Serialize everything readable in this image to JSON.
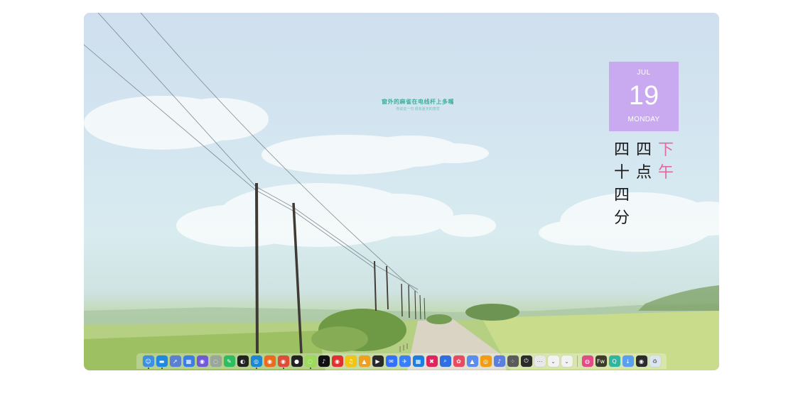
{
  "desktop": {
    "caption_main": "窗外的麻雀在电线杆上多嘴",
    "caption_sub": "你说这一句 很有夏天的感觉"
  },
  "calendar_widget": {
    "month": "JUL",
    "day": "19",
    "weekday": "MONDAY",
    "accent": "#c9a9ef"
  },
  "clock_widget": {
    "columns": [
      [
        "四",
        "十",
        "四",
        "分"
      ],
      [
        "四",
        "点"
      ],
      [
        "下",
        "午"
      ]
    ],
    "accent": "#e06b9f"
  },
  "dock": {
    "apps": [
      {
        "name": "finder",
        "glyph": "☺",
        "color": "#3d8fe0",
        "running": true
      },
      {
        "name": "photo-browser",
        "glyph": "▬",
        "color": "#1e88e5",
        "running": true
      },
      {
        "name": "launchpad",
        "glyph": "➚",
        "color": "#5b7fd1",
        "running": false
      },
      {
        "name": "app-store",
        "glyph": "▦",
        "color": "#3a7de9",
        "running": false
      },
      {
        "name": "screen-recorder",
        "glyph": "◉",
        "color": "#6f5ad8",
        "running": false
      },
      {
        "name": "wechat-chat",
        "glyph": "◌",
        "color": "#9aa59c",
        "running": false
      },
      {
        "name": "evernote",
        "glyph": "✎",
        "color": "#2dbe60",
        "running": false
      },
      {
        "name": "notion",
        "glyph": "◐",
        "color": "#222222",
        "running": false
      },
      {
        "name": "edge-browser",
        "glyph": "◎",
        "color": "#1d86d1",
        "running": true
      },
      {
        "name": "firefox",
        "glyph": "◉",
        "color": "#ec6a1c",
        "running": false
      },
      {
        "name": "chrome",
        "glyph": "◉",
        "color": "#dd4b39",
        "running": true
      },
      {
        "name": "qq",
        "glyph": "●",
        "color": "#222222",
        "running": false
      },
      {
        "name": "wechat",
        "glyph": "◌",
        "color": "#9ddc5b",
        "running": true
      },
      {
        "name": "tiktok",
        "glyph": "♪",
        "color": "#111111",
        "running": false
      },
      {
        "name": "netease-music",
        "glyph": "◉",
        "color": "#e03131",
        "running": false
      },
      {
        "name": "qq-music",
        "glyph": "♫",
        "color": "#f2c413",
        "running": false
      },
      {
        "name": "app-yellow",
        "glyph": "▲",
        "color": "#f0a020",
        "running": false
      },
      {
        "name": "app-dark",
        "glyph": "▶",
        "color": "#2b2b2b",
        "running": false
      },
      {
        "name": "feishu",
        "glyph": "✉",
        "color": "#3370ff",
        "running": false
      },
      {
        "name": "dingtalk",
        "glyph": "✈",
        "color": "#3a7ff6",
        "running": false
      },
      {
        "name": "grid-app",
        "glyph": "▦",
        "color": "#1e7de0",
        "running": false
      },
      {
        "name": "red-app",
        "glyph": "✖",
        "color": "#e0245e",
        "running": false
      },
      {
        "name": "search-app",
        "glyph": "⌕",
        "color": "#2f6fe0",
        "running": false
      },
      {
        "name": "pink-app",
        "glyph": "✿",
        "color": "#e84a5f",
        "running": false
      },
      {
        "name": "mountain-app",
        "glyph": "▲",
        "color": "#5b8dee",
        "running": false
      },
      {
        "name": "orange-app",
        "glyph": "◎",
        "color": "#f39c12",
        "running": false
      },
      {
        "name": "volume-app",
        "glyph": "♪",
        "color": "#5a7fe0",
        "running": false
      },
      {
        "name": "dots-app",
        "glyph": "⁘",
        "color": "#5b5b5b",
        "running": false
      },
      {
        "name": "power-app",
        "glyph": "⏻",
        "color": "#2b2b2b",
        "running": false
      },
      {
        "name": "more-app",
        "glyph": "⋯",
        "color": "#e8e8e8",
        "running": false
      },
      {
        "name": "expand-app-1",
        "glyph": "⌄",
        "color": "#f2f2f2",
        "running": false
      },
      {
        "name": "expand-app-2",
        "glyph": "⌄",
        "color": "#f2f2f2",
        "running": false
      }
    ],
    "apps_right": [
      {
        "name": "colorful-app",
        "glyph": "◍",
        "color": "#e24b88",
        "running": false
      },
      {
        "name": "fireworks-app",
        "glyph": "Fw",
        "color": "#3c3c28",
        "running": false
      },
      {
        "name": "qu-app",
        "glyph": "Q",
        "color": "#2fb6a0",
        "running": false
      },
      {
        "name": "download-app",
        "glyph": "↓",
        "color": "#5b9ff0",
        "running": false
      },
      {
        "name": "camera-app",
        "glyph": "◉",
        "color": "#2b2b2b",
        "running": false
      },
      {
        "name": "trash",
        "glyph": "♻",
        "color": "#d9e6f2",
        "running": false
      }
    ]
  }
}
